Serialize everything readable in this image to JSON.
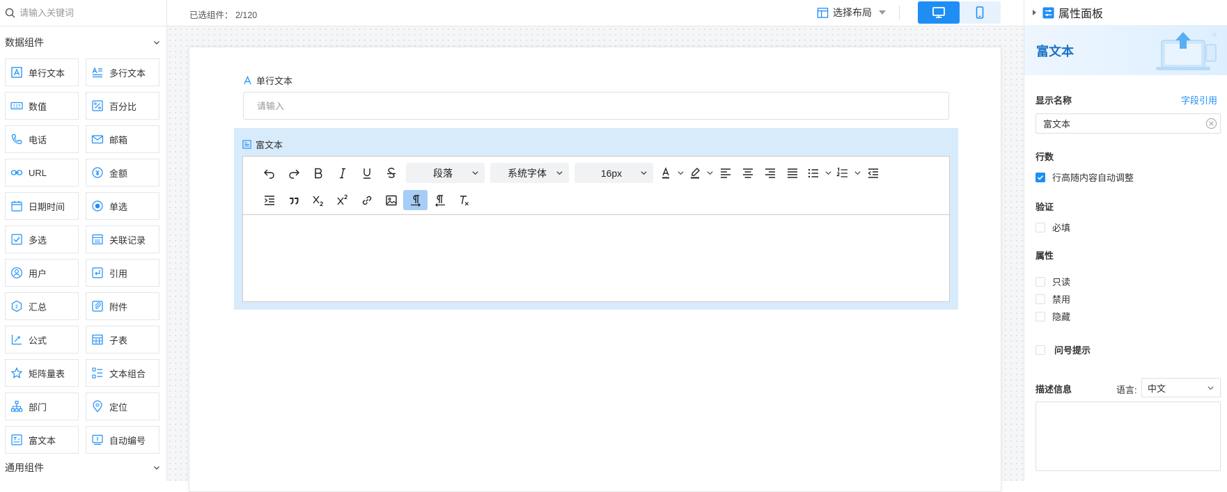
{
  "sidebar": {
    "search_placeholder": "请输入关键词",
    "group_data": "数据组件",
    "group_general": "通用组件",
    "components": [
      {
        "label": "单行文本",
        "icon": "single-line-text-icon"
      },
      {
        "label": "多行文本",
        "icon": "multi-line-text-icon"
      },
      {
        "label": "数值",
        "icon": "number-icon"
      },
      {
        "label": "百分比",
        "icon": "percent-icon"
      },
      {
        "label": "电话",
        "icon": "phone-icon"
      },
      {
        "label": "邮箱",
        "icon": "mail-icon"
      },
      {
        "label": "URL",
        "icon": "link-icon"
      },
      {
        "label": "金额",
        "icon": "currency-icon"
      },
      {
        "label": "日期时间",
        "icon": "calendar-icon"
      },
      {
        "label": "单选",
        "icon": "radio-icon"
      },
      {
        "label": "多选",
        "icon": "checkbox-icon"
      },
      {
        "label": "关联记录",
        "icon": "related-record-icon"
      },
      {
        "label": "用户",
        "icon": "user-icon"
      },
      {
        "label": "引用",
        "icon": "reference-icon"
      },
      {
        "label": "汇总",
        "icon": "summary-icon"
      },
      {
        "label": "附件",
        "icon": "attachment-icon"
      },
      {
        "label": "公式",
        "icon": "formula-icon"
      },
      {
        "label": "子表",
        "icon": "subtable-icon"
      },
      {
        "label": "矩阵量表",
        "icon": "star-icon"
      },
      {
        "label": "文本组合",
        "icon": "text-combo-icon"
      },
      {
        "label": "部门",
        "icon": "department-icon"
      },
      {
        "label": "定位",
        "icon": "location-icon"
      },
      {
        "label": "富文本",
        "icon": "rich-text-icon"
      },
      {
        "label": "自动编号",
        "icon": "auto-number-icon"
      }
    ]
  },
  "topbar": {
    "selected_count": "已选组件： 2/120",
    "layout_label": "选择布局",
    "active_device": "desktop"
  },
  "form": {
    "single_line_label": "单行文本",
    "single_line_placeholder": "请输入",
    "rich_text_label": "富文本",
    "editor": {
      "paragraph": "段落",
      "font_family": "系统字体",
      "font_size": "16px"
    }
  },
  "panel": {
    "header": "属性面板",
    "banner_title": "富文本",
    "display_name_label": "显示名称",
    "field_ref_link": "字段引用",
    "display_name_value": "富文本",
    "rows_label": "行数",
    "auto_height_label": "行高随内容自动调整",
    "auto_height_checked": true,
    "validation_label": "验证",
    "required_label": "必填",
    "attributes_label": "属性",
    "readonly_label": "只读",
    "disabled_label": "禁用",
    "hidden_label": "隐藏",
    "tooltip_label": "问号提示",
    "description_label": "描述信息",
    "language_label": "语言:",
    "language_value": "中文",
    "accent_color": "#1e8ef5"
  }
}
